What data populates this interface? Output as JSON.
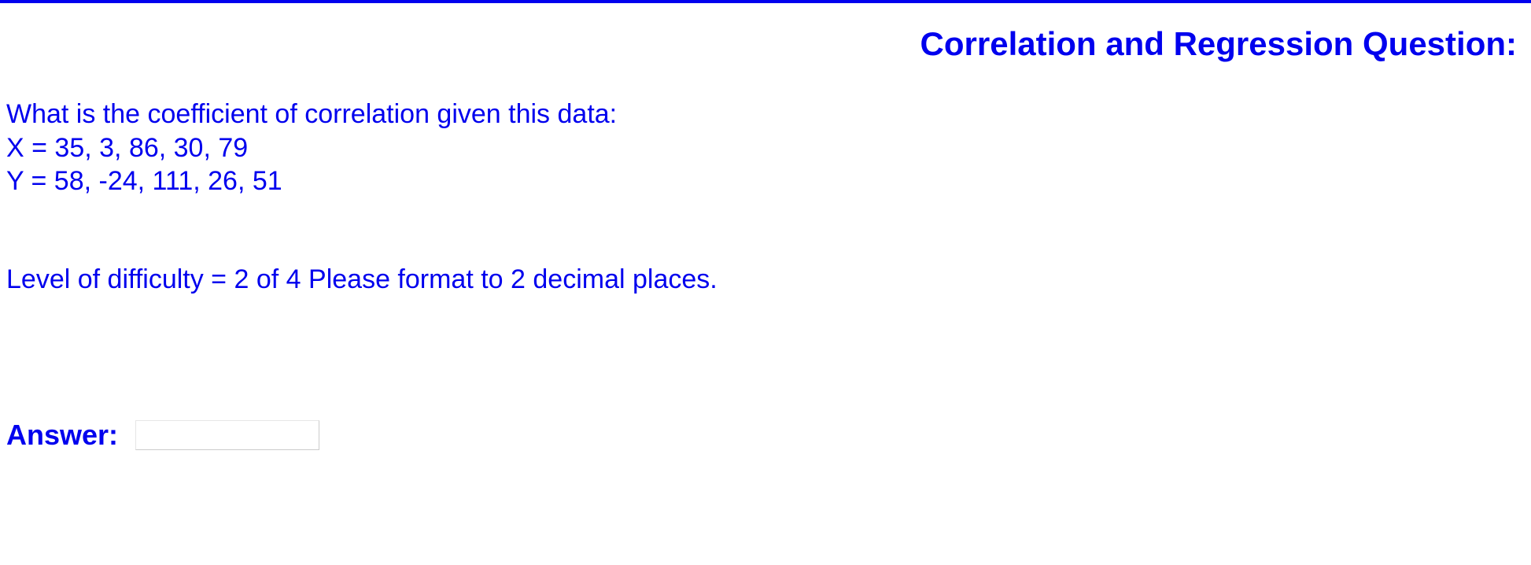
{
  "title": "Correlation and Regression Question:",
  "question": {
    "prompt": "What is the coefficient of correlation given this data:",
    "line_x": "X = 35, 3, 86, 30, 79",
    "line_y": "Y = 58, -24, 111, 26, 51"
  },
  "meta": {
    "difficulty": "Level of difficulty = 2 of 4",
    "format": "Please format to 2 decimal places."
  },
  "answer": {
    "label": "Answer:",
    "value": ""
  }
}
